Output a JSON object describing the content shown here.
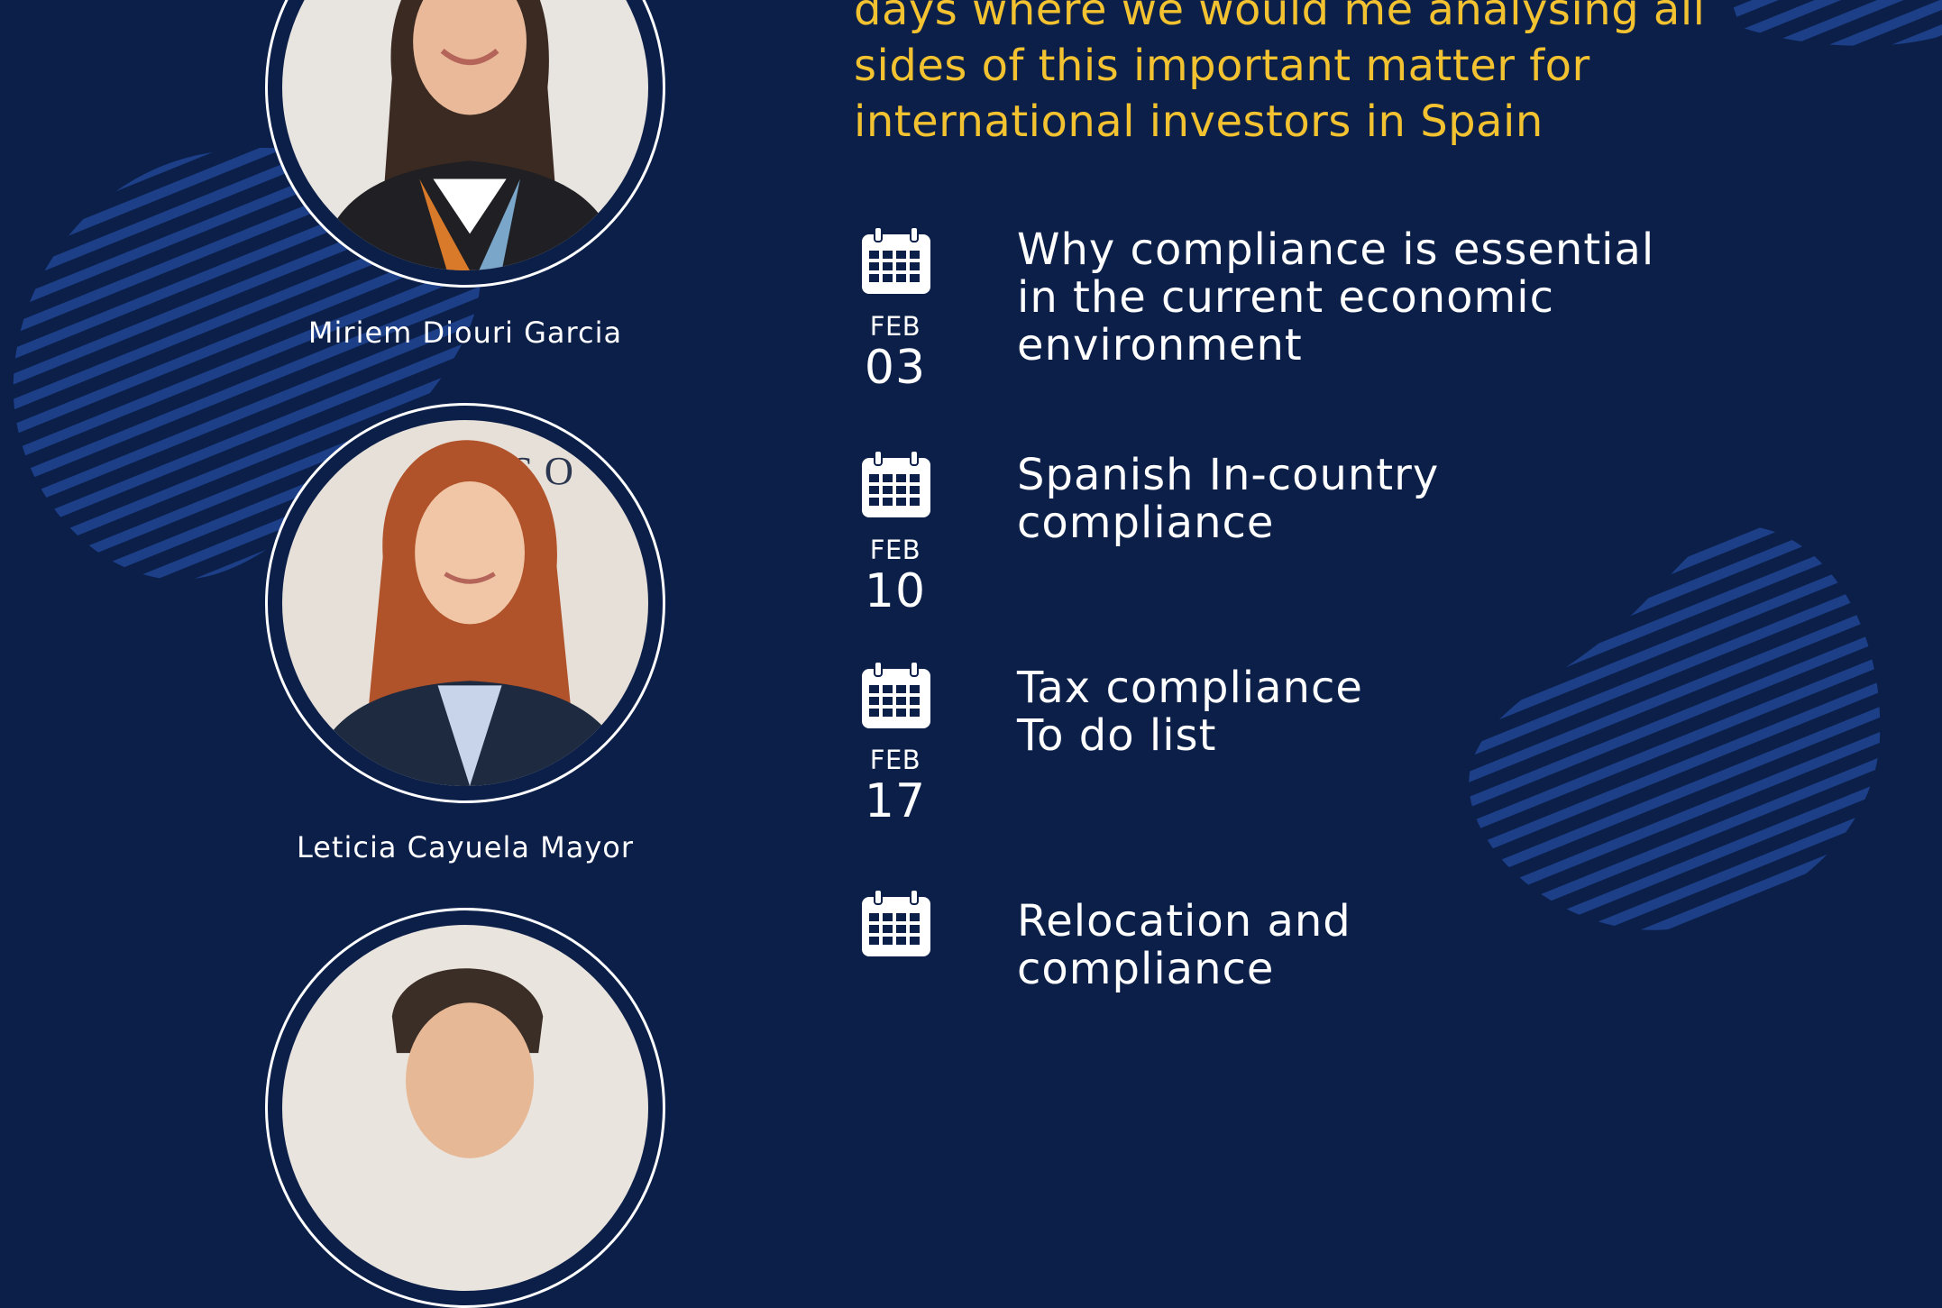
{
  "colors": {
    "background": "#0b1f49",
    "accent_text": "#f2c230",
    "stripe": "#1c3f88",
    "text": "#ffffff"
  },
  "intro": {
    "text": "days where we would me analysing all\nsides of this important matter for\ninternational investors in Spain"
  },
  "speakers": [
    {
      "name": "Miriem Diouri Garcia",
      "photo": "speaker-photo-woman-dark-hair"
    },
    {
      "name": "Leticia Cayuela Mayor",
      "photo": "speaker-photo-woman-red-hair"
    },
    {
      "name": "",
      "photo": "speaker-photo-man-partial"
    }
  ],
  "agenda": [
    {
      "icon": "calendar-icon",
      "month": "FEB",
      "day": "03",
      "title": "Why compliance is essential\nin the current economic\nenvironment"
    },
    {
      "icon": "calendar-icon",
      "month": "FEB",
      "day": "10",
      "title": "Spanish In-country\ncompliance"
    },
    {
      "icon": "calendar-icon",
      "month": "FEB",
      "day": "17",
      "title": "Tax compliance\nTo do list"
    },
    {
      "icon": "calendar-icon",
      "month": "",
      "day": "",
      "title": "Relocation and\ncompliance"
    }
  ]
}
